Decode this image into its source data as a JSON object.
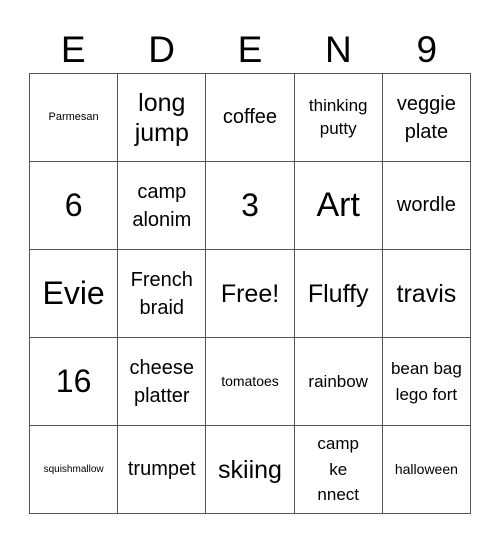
{
  "header": {
    "letters": [
      "E",
      "D",
      "E",
      "N",
      "9"
    ]
  },
  "board": {
    "cells": [
      [
        "Parmesan",
        "long jump",
        "coffee",
        "thinking putty",
        "veggie plate"
      ],
      [
        "6",
        "camp alonim",
        "3",
        "Art",
        "wordle"
      ],
      [
        "Evie",
        "French braid",
        "Free!",
        "Fluffy",
        "travis"
      ],
      [
        "16",
        "cheese platter",
        "tomatoes",
        "rainbow",
        "bean bag lego fort"
      ],
      [
        "squishmallow",
        "trumpet",
        "skiing",
        "camp ke nnect",
        "halloween"
      ]
    ],
    "free_space": "Free!"
  }
}
